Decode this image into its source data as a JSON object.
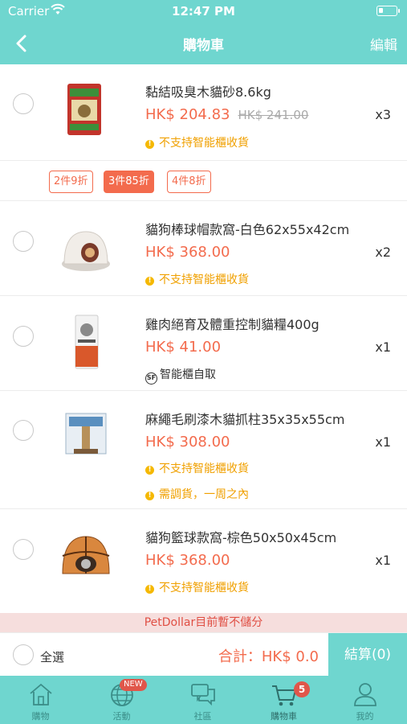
{
  "status": {
    "carrier": "Carrier",
    "time": "12:47 PM",
    "battery_level": 0.25
  },
  "header": {
    "title": "購物車",
    "edit": "編輯"
  },
  "items": [
    {
      "name": "黏結吸臭木貓砂8.6kg",
      "price": "HK$ 204.83",
      "old_price": "HK$ 241.00",
      "qty": "x3",
      "notes": [
        "不支持智能櫃收貨"
      ]
    },
    {
      "name": "貓狗棒球帽款窩-白色62x55x42cm",
      "price": "HK$ 368.00",
      "qty": "x2",
      "notes": [
        "不支持智能櫃收貨"
      ]
    },
    {
      "name": "雞肉絕育及體重控制貓糧400g",
      "price": "HK$ 41.00",
      "qty": "x1",
      "sf_note": "智能櫃自取",
      "sf_icon": "SF"
    },
    {
      "name": "麻繩毛刷漆木貓抓柱35x35x55cm",
      "price": "HK$ 308.00",
      "qty": "x1",
      "notes": [
        "不支持智能櫃收貨",
        "需調貨，一周之內"
      ]
    },
    {
      "name": "貓狗籃球款窩-棕色50x50x45cm",
      "price": "HK$ 368.00",
      "qty": "x1",
      "notes": [
        "不支持智能櫃收貨"
      ]
    }
  ],
  "promos": [
    "2件9折",
    "3件85折",
    "4件8折"
  ],
  "promo_active_index": 1,
  "notice": "PetDollar目前暫不儲分",
  "checkout": {
    "select_all": "全選",
    "total": "合計：HK$ 0.0",
    "pay": "結算(0)"
  },
  "tabs": [
    {
      "label": "購物",
      "icon": "home-icon"
    },
    {
      "label": "活動",
      "icon": "globe-icon",
      "badge": "NEW"
    },
    {
      "label": "社區",
      "icon": "chat-icon"
    },
    {
      "label": "購物車",
      "icon": "cart-icon",
      "badge": "5"
    },
    {
      "label": "我的",
      "icon": "person-icon"
    }
  ],
  "colors": {
    "teal": "#6fd6cf",
    "price": "#f36b4d",
    "warn": "#f5b800",
    "badge": "#e0564a"
  }
}
